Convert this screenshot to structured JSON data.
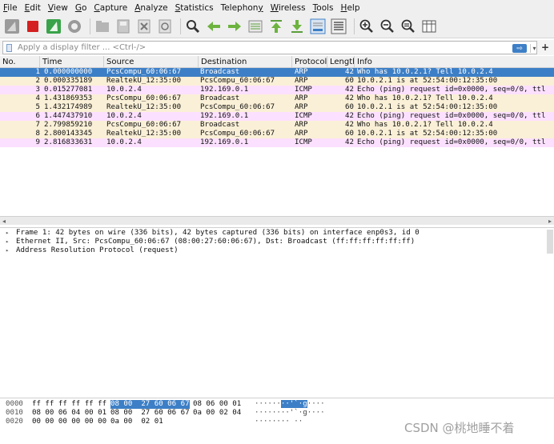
{
  "menu": {
    "items": [
      {
        "label": "File",
        "u": "F"
      },
      {
        "label": "Edit",
        "u": "E"
      },
      {
        "label": "View",
        "u": "V"
      },
      {
        "label": "Go",
        "u": "G"
      },
      {
        "label": "Capture",
        "u": "C"
      },
      {
        "label": "Analyze",
        "u": "A"
      },
      {
        "label": "Statistics",
        "u": "S"
      },
      {
        "label": "Telephony",
        "u": "y"
      },
      {
        "label": "Wireless",
        "u": "W"
      },
      {
        "label": "Tools",
        "u": "T"
      },
      {
        "label": "Help",
        "u": "H"
      }
    ]
  },
  "toolbar": {
    "icons": [
      "shark-fin-start-icon",
      "stop-capture-icon",
      "restart-capture-icon",
      "capture-options-icon",
      "open-file-icon",
      "save-file-icon",
      "close-file-icon",
      "reload-file-icon",
      "find-packet-icon",
      "go-back-icon",
      "go-forward-icon",
      "go-to-packet-icon",
      "go-first-packet-icon",
      "go-last-packet-icon",
      "autoscroll-icon",
      "colorize-icon",
      "zoom-in-icon",
      "zoom-out-icon",
      "zoom-normal-icon",
      "resize-columns-icon"
    ]
  },
  "filter": {
    "placeholder": "Apply a display filter ... <Ctrl-/>",
    "apply_symbol": "⇨",
    "dropdown_symbol": "▾",
    "add_symbol": "+"
  },
  "packet_list": {
    "columns": [
      "No.",
      "Time",
      "Source",
      "Destination",
      "Protocol",
      "Length",
      "Info"
    ],
    "selected_color": "#3d7fc6",
    "arp_color": "#faf0d7",
    "icmp_color": "#fce0ff",
    "rows": [
      {
        "no": "1",
        "time": "0.000000000",
        "source": "PcsCompu_60:06:67",
        "destination": "Broadcast",
        "protocol": "ARP",
        "length": "42",
        "info": "Who has 10.0.2.1? Tell 10.0.2.4",
        "selected": true
      },
      {
        "no": "2",
        "time": "0.000335189",
        "source": "RealtekU_12:35:00",
        "destination": "PcsCompu_60:06:67",
        "protocol": "ARP",
        "length": "60",
        "info": "10.0.2.1 is at 52:54:00:12:35:00",
        "selected": false
      },
      {
        "no": "3",
        "time": "0.015277081",
        "source": "10.0.2.4",
        "destination": "192.169.0.1",
        "protocol": "ICMP",
        "length": "42",
        "info": "Echo (ping) request  id=0x0000, seq=0/0, ttl",
        "selected": false
      },
      {
        "no": "4",
        "time": "1.431869353",
        "source": "PcsCompu_60:06:67",
        "destination": "Broadcast",
        "protocol": "ARP",
        "length": "42",
        "info": "Who has 10.0.2.1? Tell 10.0.2.4",
        "selected": false
      },
      {
        "no": "5",
        "time": "1.432174989",
        "source": "RealtekU_12:35:00",
        "destination": "PcsCompu_60:06:67",
        "protocol": "ARP",
        "length": "60",
        "info": "10.0.2.1 is at 52:54:00:12:35:00",
        "selected": false
      },
      {
        "no": "6",
        "time": "1.447437910",
        "source": "10.0.2.4",
        "destination": "192.169.0.1",
        "protocol": "ICMP",
        "length": "42",
        "info": "Echo (ping) request  id=0x0000, seq=0/0, ttl",
        "selected": false
      },
      {
        "no": "7",
        "time": "2.799859210",
        "source": "PcsCompu_60:06:67",
        "destination": "Broadcast",
        "protocol": "ARP",
        "length": "42",
        "info": "Who has 10.0.2.1? Tell 10.0.2.4",
        "selected": false
      },
      {
        "no": "8",
        "time": "2.800143345",
        "source": "RealtekU_12:35:00",
        "destination": "PcsCompu_60:06:67",
        "protocol": "ARP",
        "length": "60",
        "info": "10.0.2.1 is at 52:54:00:12:35:00",
        "selected": false
      },
      {
        "no": "9",
        "time": "2.816833631",
        "source": "10.0.2.4",
        "destination": "192.169.0.1",
        "protocol": "ICMP",
        "length": "42",
        "info": "Echo (ping) request  id=0x0000, seq=0/0, ttl",
        "selected": false
      }
    ]
  },
  "details": {
    "rows": [
      "Frame 1: 42 bytes on wire (336 bits), 42 bytes captured (336 bits) on interface enp0s3, id 0",
      "Ethernet II, Src: PcsCompu_60:06:67 (08:00:27:60:06:67), Dst: Broadcast (ff:ff:ff:ff:ff:ff)",
      "Address Resolution Protocol (request)"
    ],
    "expander": "▸"
  },
  "bytes": {
    "rows": [
      {
        "offset": "0000",
        "hex1": "ff ff ff ff ff ff",
        "hex2": "08 00  27 60 06 67",
        "hex3": "08 06 00 01",
        "ascii_plain": "······",
        "ascii_hl": "··'`·g",
        "ascii_tail": "····",
        "hl": true
      },
      {
        "offset": "0010",
        "hex1": "08 00 06 04 00 01",
        "hex2": "08 00  27 60 06 67",
        "hex3": "0a 00 02 04",
        "ascii_plain": "········",
        "ascii_hl": "",
        "ascii_tail": "'`·g····",
        "hl": false
      },
      {
        "offset": "0020",
        "hex1": "00 00 00 00 00 00",
        "hex2": "0a 00  02 01",
        "hex3": "",
        "ascii_plain": "········ ··",
        "ascii_hl": "",
        "ascii_tail": "",
        "hl": false
      }
    ]
  },
  "watermark": "CSDN @桃地睡不着"
}
